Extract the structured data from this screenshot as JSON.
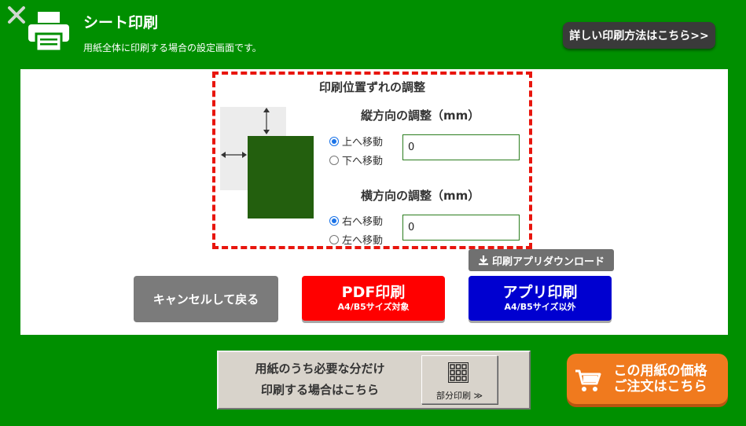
{
  "header": {
    "title": "シート印刷",
    "subtitle": "用紙全体に印刷する場合の設定画面です。",
    "help_button": "詳しい印刷方法はこちら>>"
  },
  "adjust": {
    "title": "印刷位置ずれの調整",
    "vertical": {
      "title": "縦方向の調整（mm）",
      "option_up": "上へ移動",
      "option_down": "下へ移動",
      "selected": "up",
      "value": "0"
    },
    "horizontal": {
      "title": "横方向の調整（mm）",
      "option_right": "右へ移動",
      "option_left": "左へ移動",
      "selected": "right",
      "value": "0"
    }
  },
  "download_button": "印刷アプリダウンロード",
  "buttons": {
    "cancel": "キャンセルして戻る",
    "pdf_main": "PDF印刷",
    "pdf_sub": "A4/B5サイズ対象",
    "app_main": "アプリ印刷",
    "app_sub": "A4/B5サイズ以外"
  },
  "partial": {
    "line1": "用紙のうち必要な分だけ",
    "line2": "印刷する場合はこちら",
    "button_label": "部分印刷 ≫"
  },
  "order": {
    "line1": "この用紙の価格",
    "line2": "ご注文はこちら"
  },
  "colors": {
    "background": "#008f00",
    "dashed_border": "#e8150d",
    "pdf_button": "#ff0000",
    "app_button": "#0000d0",
    "order_button": "#f07a1e"
  }
}
